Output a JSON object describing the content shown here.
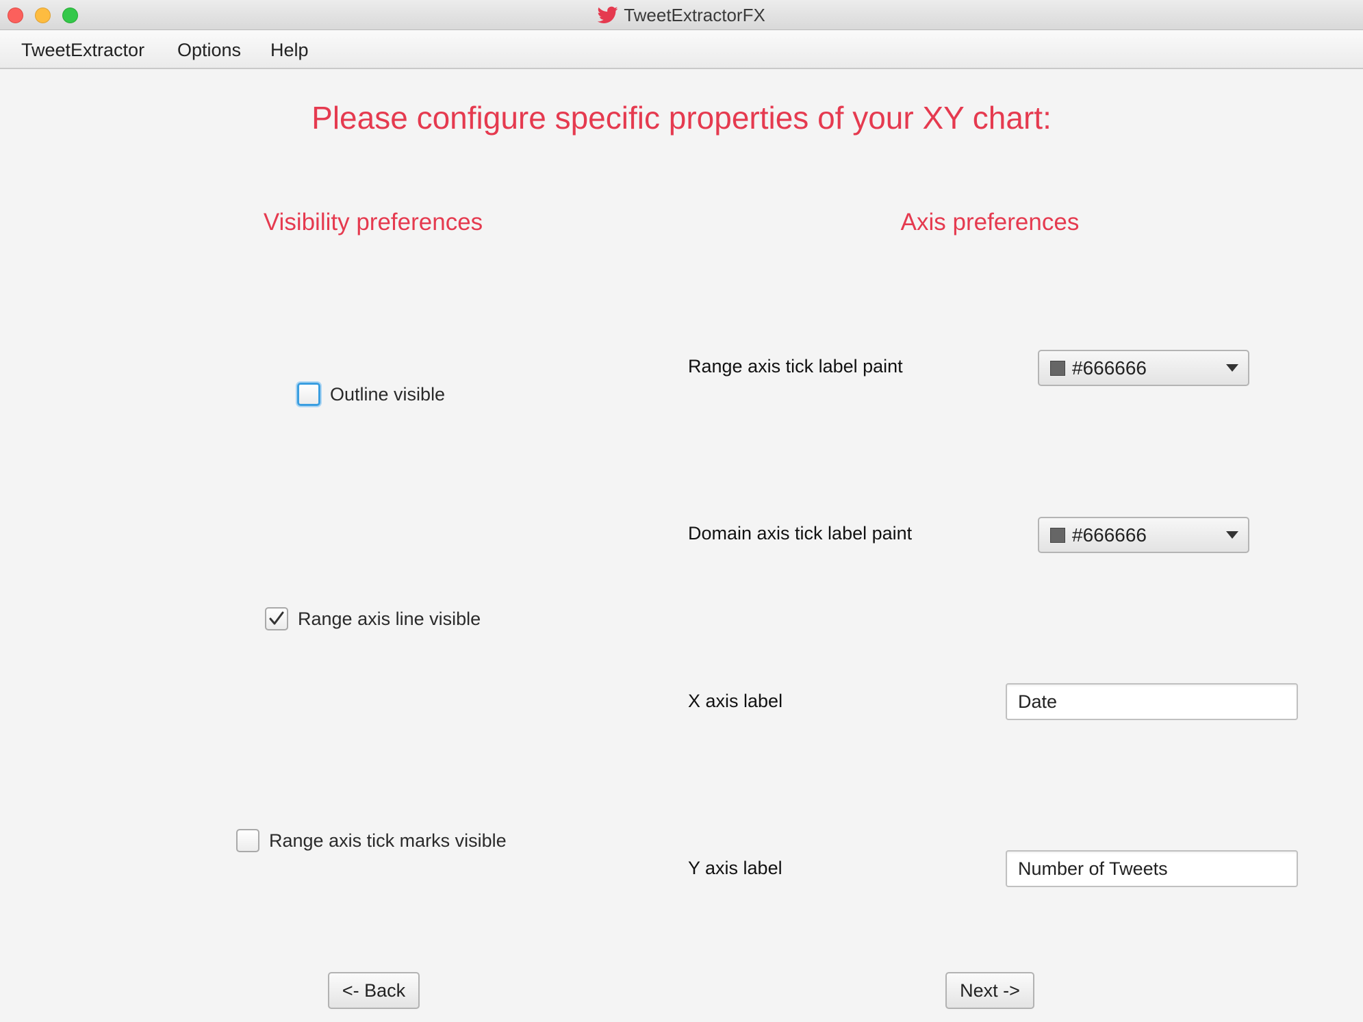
{
  "window": {
    "title": "TweetExtractorFX"
  },
  "menu": {
    "items": [
      "TweetExtractor",
      "Options",
      "Help"
    ]
  },
  "page": {
    "heading": "Please configure specific properties of your XY chart:"
  },
  "visibility": {
    "heading": "Visibility preferences",
    "options": [
      {
        "label": "Outline visible",
        "checked": false,
        "focused": true
      },
      {
        "label": "Range axis line visible",
        "checked": true,
        "focused": false
      },
      {
        "label": "Range axis tick marks visible",
        "checked": false,
        "focused": false
      }
    ]
  },
  "axis": {
    "heading": "Axis preferences",
    "range_tick_paint": {
      "label": "Range axis tick label paint",
      "value": "#666666",
      "swatch": "#666666"
    },
    "domain_tick_paint": {
      "label": "Domain axis tick label paint",
      "value": "#666666",
      "swatch": "#666666"
    },
    "x_label": {
      "label": "X axis label",
      "value": "Date"
    },
    "y_label": {
      "label": "Y axis label",
      "value": "Number of Tweets"
    }
  },
  "buttons": {
    "back": "<- Back",
    "next": "Next ->"
  },
  "colors": {
    "accent": "#e53a4f",
    "twitter": "#e53a4f",
    "focus": "#3a9ee0"
  }
}
